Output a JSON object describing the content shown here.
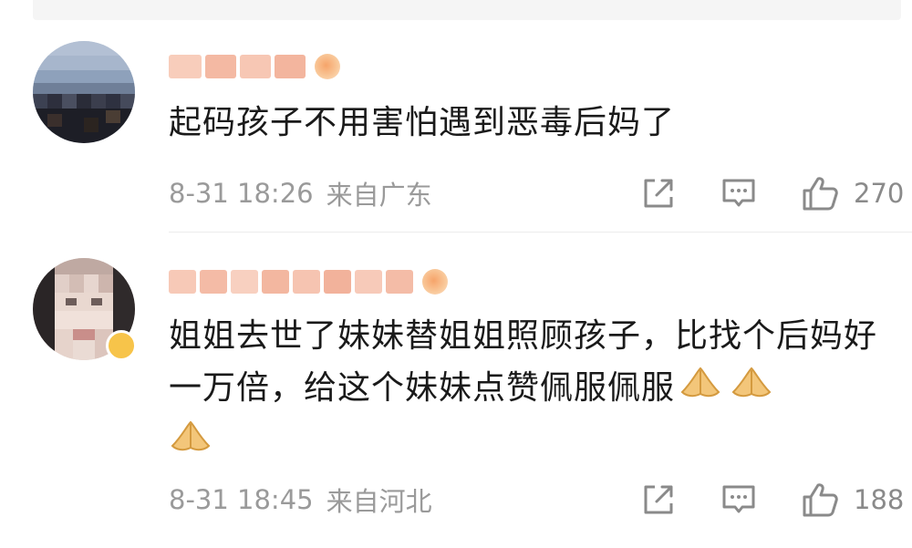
{
  "comments": [
    {
      "username": "",
      "text": "起码孩子不用害怕遇到恶毒后妈了",
      "date": "8-31 18:26",
      "location": "来自广东",
      "likes": "270",
      "icons": [
        "share-icon",
        "comment-icon",
        "like-icon"
      ]
    },
    {
      "username": "",
      "text": "姐姐去世了妹妹替姐姐照顾孩子，比找个后妈好一万倍，给这个妹妹点赞佩服佩服",
      "emoji": [
        "praying-hands-emoji",
        "praying-hands-emoji",
        "praying-hands-emoji"
      ],
      "date": "8-31 18:45",
      "location": "来自河北",
      "likes": "188",
      "icons": [
        "share-icon",
        "comment-icon",
        "like-icon"
      ]
    }
  ],
  "colors": {
    "meta_gray": "#9a9a9a",
    "text": "#1a1a1a",
    "username_blur": "#f6c3b0",
    "vip_badge": "#f7c44a"
  }
}
